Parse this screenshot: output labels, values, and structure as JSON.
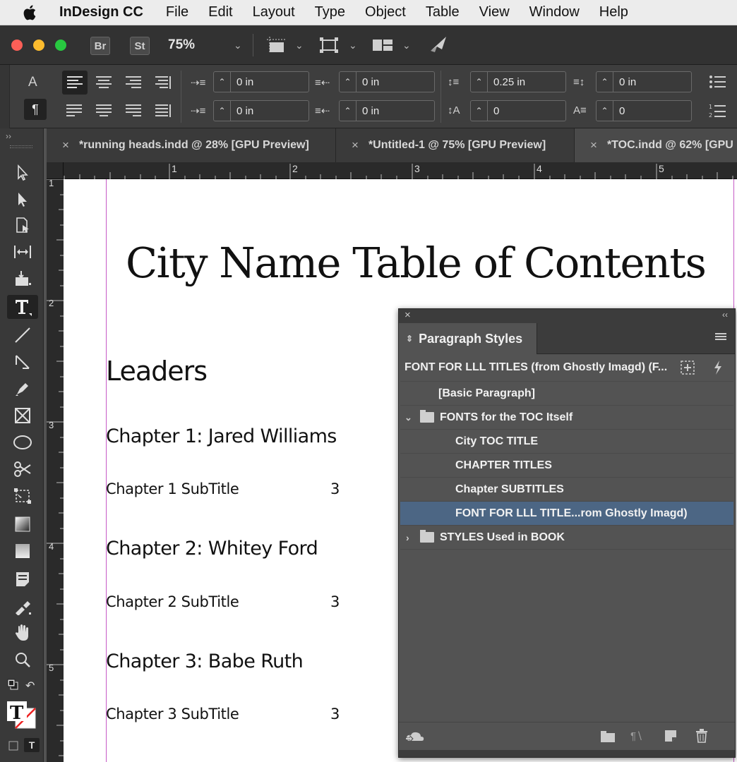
{
  "menubar": {
    "app_name": "InDesign CC",
    "items": [
      "File",
      "Edit",
      "Layout",
      "Type",
      "Object",
      "Table",
      "View",
      "Window",
      "Help"
    ]
  },
  "app_toolbar": {
    "bridge_label": "Br",
    "stock_label": "St",
    "zoom": "75%"
  },
  "control_panel": {
    "char_mode_label": "A",
    "para_mode_label": "¶",
    "left_indent": "0 in",
    "right_indent": "0 in",
    "space_before": "0.25 in",
    "space_after": "0 in",
    "first_line_indent": "0 in",
    "last_line_indent": "0 in",
    "drop_cap_lines": "0",
    "drop_cap_chars": "0"
  },
  "tabs": [
    {
      "label": "*running heads.indd @ 28% [GPU Preview]"
    },
    {
      "label": "*Untitled-1 @ 75% [GPU Preview]"
    },
    {
      "label": "*TOC.indd @ 62% [GPU Preview]"
    }
  ],
  "rulers": {
    "h": [
      "1",
      "2",
      "3",
      "4",
      "5"
    ],
    "v": [
      "1",
      "2",
      "3",
      "4",
      "5"
    ]
  },
  "document": {
    "title": "City Name Table of Contents",
    "section": "Leaders",
    "chapters": [
      {
        "title": "Chapter 1: Jared Williams",
        "subtitle": "Chapter 1 SubTitle",
        "page": "3"
      },
      {
        "title": "Chapter 2: Whitey Ford",
        "subtitle": "Chapter 2 SubTitle",
        "page": "3"
      },
      {
        "title": "Chapter 3: Babe Ruth",
        "subtitle": "Chapter 3 SubTitle",
        "page": "3"
      }
    ]
  },
  "paragraph_styles_panel": {
    "tab_label": "Paragraph Styles",
    "current_style": "FONT FOR LLL TITLES (from Ghostly Imagd) (F...",
    "items": [
      {
        "label": "[Basic Paragraph]"
      },
      {
        "label": "FONTS for the TOC Itself"
      },
      {
        "label": "City TOC TITLE"
      },
      {
        "label": "CHAPTER TITLES"
      },
      {
        "label": "Chapter SUBTITLES"
      },
      {
        "label": "FONT FOR LLL TITLE...rom Ghostly Imagd)"
      },
      {
        "label": "STYLES Used in BOOK"
      }
    ]
  },
  "colors": {
    "selection": "#4c6684",
    "margin_guide": "#c65ac6",
    "pasteboard": "#535353"
  }
}
